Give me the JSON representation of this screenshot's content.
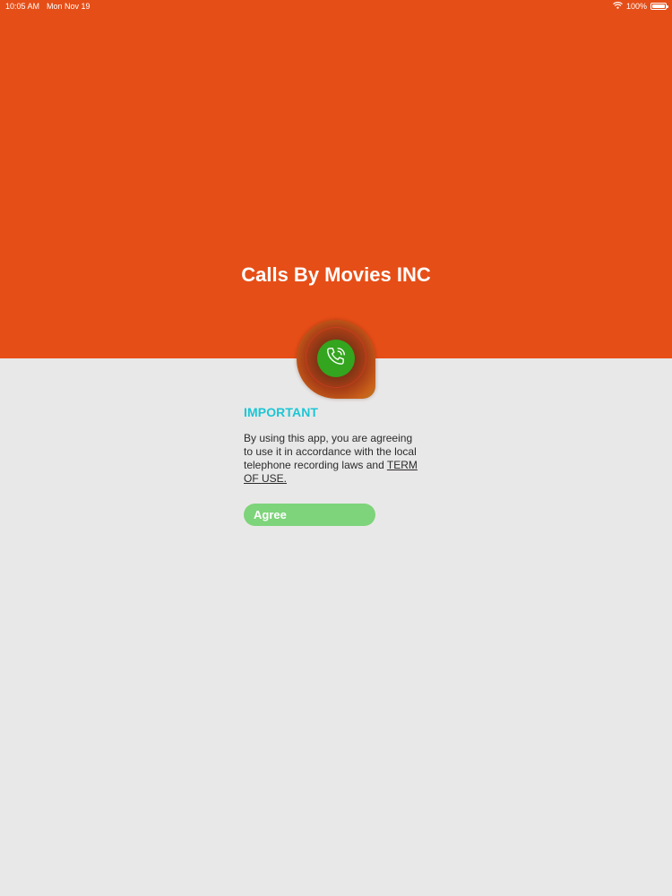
{
  "status_bar": {
    "time": "10:05 AM",
    "date": "Mon Nov 19",
    "battery_percent": "100%",
    "battery_level": 1.0,
    "icons": [
      "wifi-icon",
      "battery-icon"
    ]
  },
  "header": {
    "title": "Calls By Movies INC",
    "background_color": "#e64e17"
  },
  "logo": {
    "icon": "phone-call-icon",
    "accent_color": "#33a51e"
  },
  "notice": {
    "heading": "IMPORTANT",
    "heading_color": "#1dc6d5",
    "body_text": "By using this app, you are agreeing to use it in accordance with the local telephone recording laws and ",
    "terms_link": "TERM OF USE."
  },
  "actions": {
    "agree_label": "Agree",
    "agree_color": "#7dd47a"
  }
}
